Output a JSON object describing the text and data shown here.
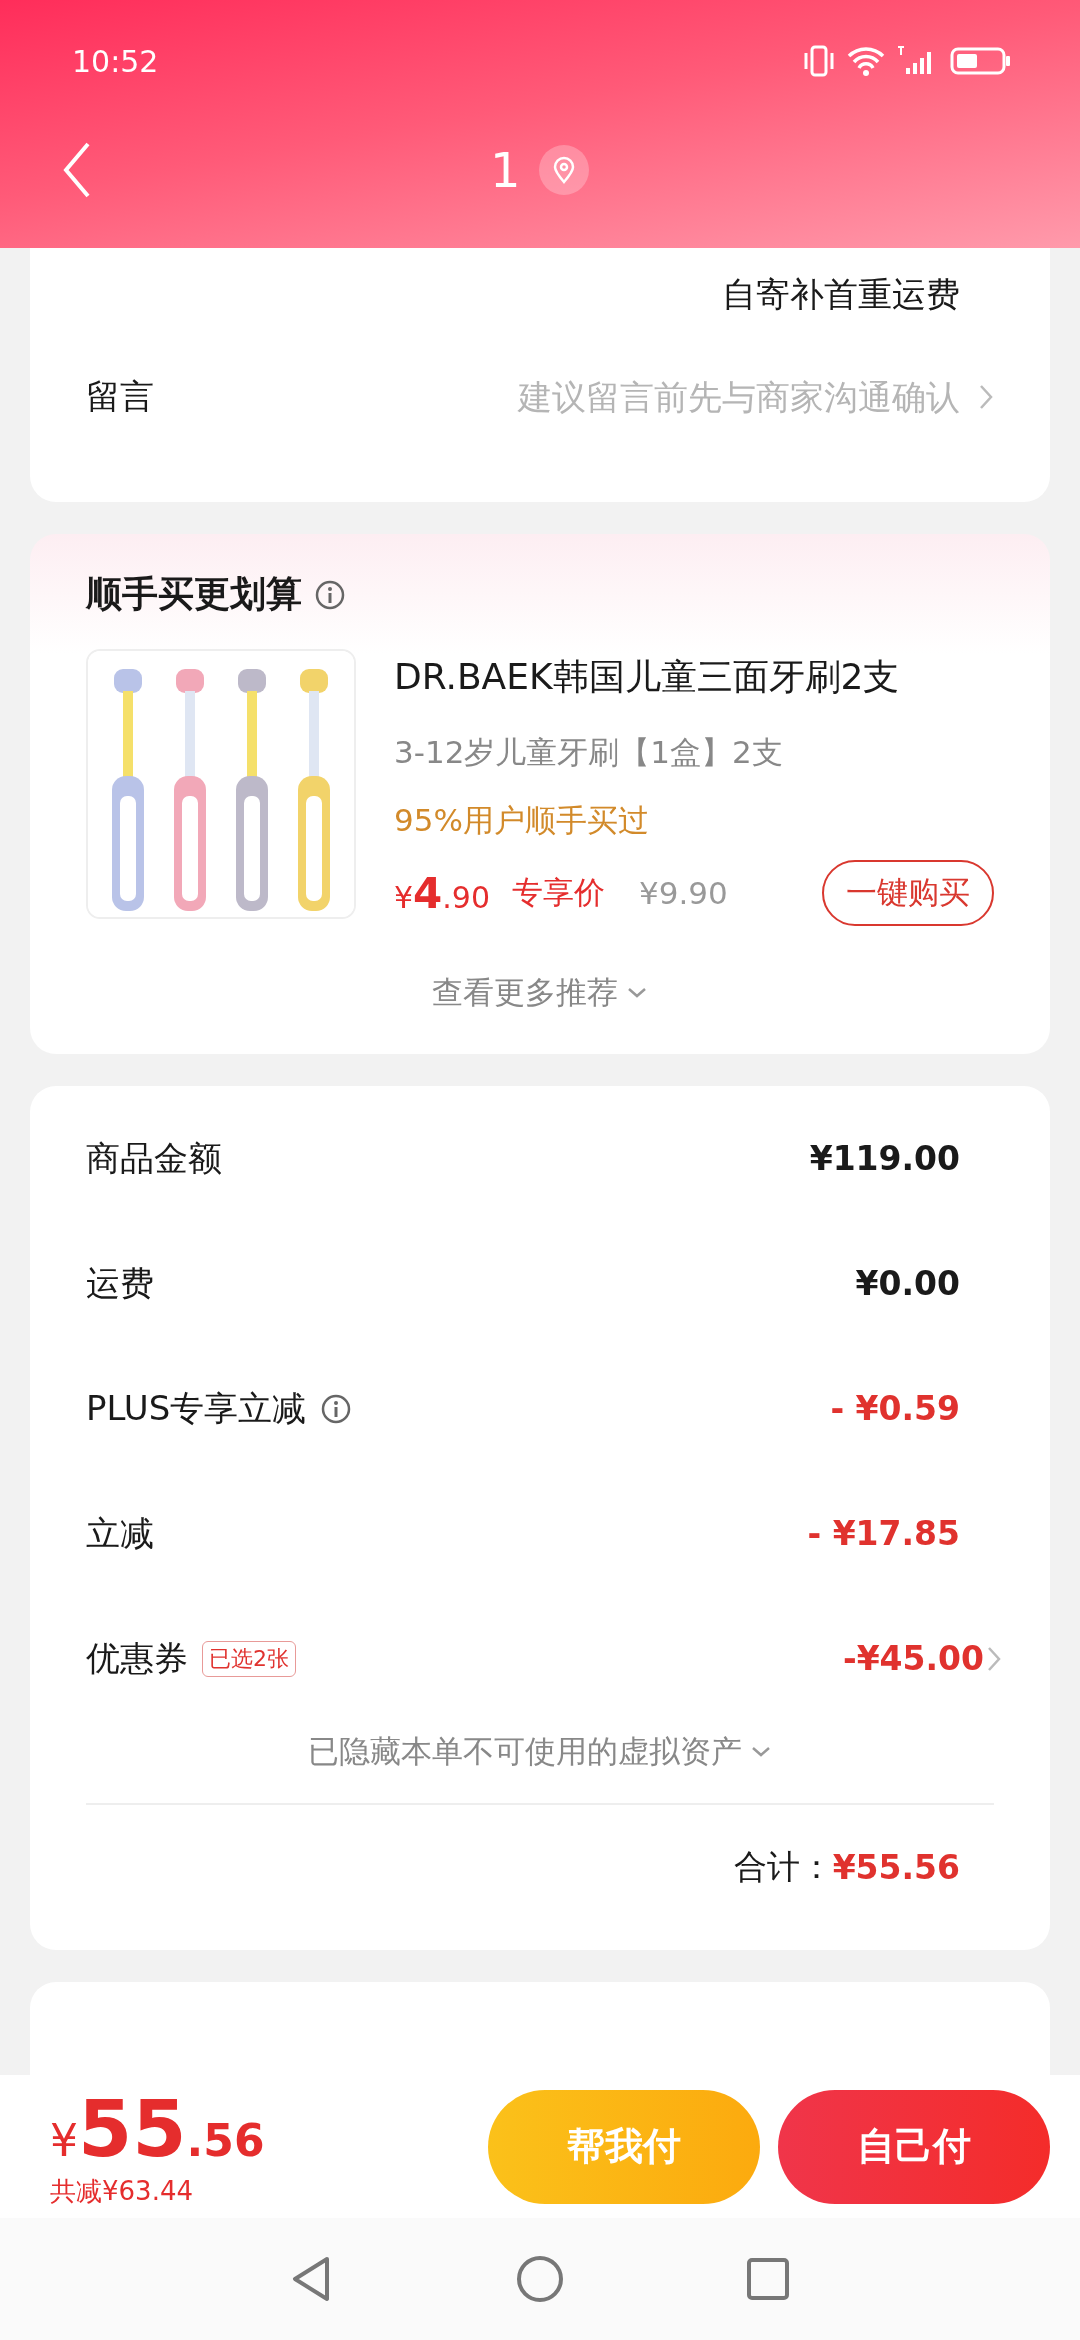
{
  "status_bar": {
    "time": "10:52"
  },
  "nav": {
    "title": "1"
  },
  "shipping": {
    "note": "自寄补首重运费"
  },
  "message": {
    "label": "留言",
    "placeholder": "建议留言前先与商家沟通确认"
  },
  "recommend": {
    "title": "顺手买更划算",
    "product": {
      "name": "DR.BAEK韩国儿童三面牙刷2支",
      "spec": "3-12岁儿童牙刷【1盒】2支",
      "hint": "95%用户顺手买过",
      "price_symbol": "¥",
      "price_int": "4",
      "price_dec": ".90",
      "price_tag": "专享价",
      "original_price": "¥9.90",
      "buy_button": "一键购买"
    },
    "more": "查看更多推荐"
  },
  "summary": {
    "rows": [
      {
        "label": "商品金额",
        "value": "¥119.00",
        "kind": "plain"
      },
      {
        "label": "运费",
        "value": "¥0.00",
        "kind": "plain"
      },
      {
        "label": "PLUS专享立减",
        "value": "- ¥0.59",
        "kind": "info"
      },
      {
        "label": "立减",
        "value": "- ¥17.85",
        "kind": "discount"
      },
      {
        "label": "优惠券",
        "value": "-¥45.00",
        "kind": "coupon",
        "tag": "已选2张"
      }
    ],
    "hidden_note": "已隐藏本单不可使用的虚拟资产",
    "total_label": "合计：",
    "total_value": "¥55.56"
  },
  "footer": {
    "symbol": "¥",
    "amount_int": "55",
    "amount_dec": ".56",
    "saved": "共减¥63.44",
    "buttons": [
      {
        "label": "帮我付",
        "kind": "secondary"
      },
      {
        "label": "自己付",
        "kind": "primary"
      }
    ]
  }
}
